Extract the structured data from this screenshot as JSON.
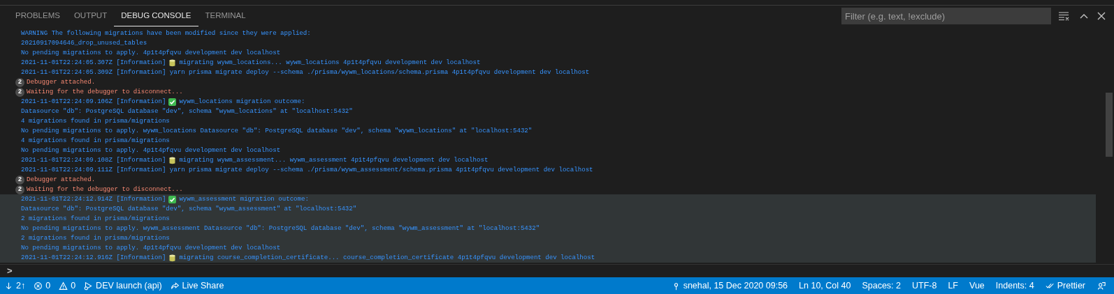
{
  "tabs": [
    {
      "label": "PROBLEMS",
      "selected": false
    },
    {
      "label": "OUTPUT",
      "selected": false
    },
    {
      "label": "DEBUG CONSOLE",
      "selected": true
    },
    {
      "label": "TERMINAL",
      "selected": false
    }
  ],
  "filter": {
    "placeholder": "Filter (e.g. text, !exclude)"
  },
  "console_lines": [
    {
      "kind": "log",
      "text": "WARNING The following migrations have been modified since they were applied:",
      "highlighted": false
    },
    {
      "kind": "log",
      "text": "20210917094646_drop_unused_tables",
      "highlighted": false
    },
    {
      "kind": "log",
      "text": "No pending migrations to apply. 4p1t4pfqvu development dev localhost",
      "highlighted": false
    },
    {
      "kind": "db_log",
      "before": "2021-11-01T22:24:05.307Z [Information]",
      "after": "migrating wywm_locations... wywm_locations 4p1t4pfqvu development dev localhost",
      "highlighted": false
    },
    {
      "kind": "log",
      "text": "2021-11-01T22:24:05.309Z [Information] yarn prisma migrate deploy --schema ./prisma/wywm_locations/schema.prisma 4p1t4pfqvu development dev localhost",
      "highlighted": false
    },
    {
      "kind": "debugger",
      "count": "2",
      "text": "Debugger attached.",
      "highlighted": false
    },
    {
      "kind": "debugger",
      "count": "2",
      "text": "Waiting for the debugger to disconnect...",
      "highlighted": false
    },
    {
      "kind": "check_log",
      "before": "2021-11-01T22:24:09.106Z [Information]",
      "after": "wywm_locations migration outcome:",
      "highlighted": false
    },
    {
      "kind": "log",
      "text": "Datasource \"db\": PostgreSQL database \"dev\", schema \"wywm_locations\" at \"localhost:5432\"",
      "highlighted": false
    },
    {
      "kind": "log",
      "text": "4 migrations found in prisma/migrations",
      "highlighted": false
    },
    {
      "kind": "log",
      "text": "No pending migrations to apply. wywm_locations Datasource \"db\": PostgreSQL database \"dev\", schema \"wywm_locations\" at \"localhost:5432\"",
      "highlighted": false
    },
    {
      "kind": "log",
      "text": "4 migrations found in prisma/migrations",
      "highlighted": false
    },
    {
      "kind": "log",
      "text": "No pending migrations to apply. 4p1t4pfqvu development dev localhost",
      "highlighted": false
    },
    {
      "kind": "db_log",
      "before": "2021-11-01T22:24:09.108Z [Information]",
      "after": "migrating wywm_assessment... wywm_assessment 4p1t4pfqvu development dev localhost",
      "highlighted": false
    },
    {
      "kind": "log",
      "text": "2021-11-01T22:24:09.111Z [Information] yarn prisma migrate deploy --schema ./prisma/wywm_assessment/schema.prisma 4p1t4pfqvu development dev localhost",
      "highlighted": false
    },
    {
      "kind": "debugger",
      "count": "2",
      "text": "Debugger attached.",
      "highlighted": false
    },
    {
      "kind": "debugger",
      "count": "2",
      "text": "Waiting for the debugger to disconnect...",
      "highlighted": false
    },
    {
      "kind": "check_log",
      "before": "2021-11-01T22:24:12.914Z [Information]",
      "after": "wywm_assessment migration outcome:",
      "highlighted": true
    },
    {
      "kind": "log",
      "text": "Datasource \"db\": PostgreSQL database \"dev\", schema \"wywm_assessment\" at \"localhost:5432\"",
      "highlighted": true
    },
    {
      "kind": "log",
      "text": "2 migrations found in prisma/migrations",
      "highlighted": true
    },
    {
      "kind": "log",
      "text": "No pending migrations to apply. wywm_assessment Datasource \"db\": PostgreSQL database \"dev\", schema \"wywm_assessment\" at \"localhost:5432\"",
      "highlighted": true
    },
    {
      "kind": "log",
      "text": "2 migrations found in prisma/migrations",
      "highlighted": true
    },
    {
      "kind": "log",
      "text": "No pending migrations to apply. 4p1t4pfqvu development dev localhost",
      "highlighted": true
    },
    {
      "kind": "db_log",
      "before": "2021-11-01T22:24:12.916Z [Information]",
      "after": "migrating course_completion_certificate... course_completion_certificate 4p1t4pfqvu development dev localhost",
      "highlighted": true
    }
  ],
  "prompt": ">",
  "status_bar": {
    "left": [
      {
        "kind": "sync",
        "text": "2↑"
      },
      {
        "kind": "error",
        "text": "0"
      },
      {
        "kind": "warning",
        "text": "0"
      },
      {
        "kind": "debug",
        "text": "DEV launch (api)"
      },
      {
        "kind": "share",
        "text": "Live Share"
      }
    ],
    "right": [
      {
        "kind": "commit",
        "text": "snehal, 15 Dec 2020 09:56"
      },
      {
        "kind": "plain",
        "text": "Ln 10, Col 40"
      },
      {
        "kind": "plain",
        "text": "Spaces: 2"
      },
      {
        "kind": "plain",
        "text": "UTF-8"
      },
      {
        "kind": "plain",
        "text": "LF"
      },
      {
        "kind": "plain",
        "text": "Vue"
      },
      {
        "kind": "plain",
        "text": "Indents: 4"
      },
      {
        "kind": "checks",
        "text": "Prettier"
      },
      {
        "kind": "feedback"
      }
    ]
  }
}
